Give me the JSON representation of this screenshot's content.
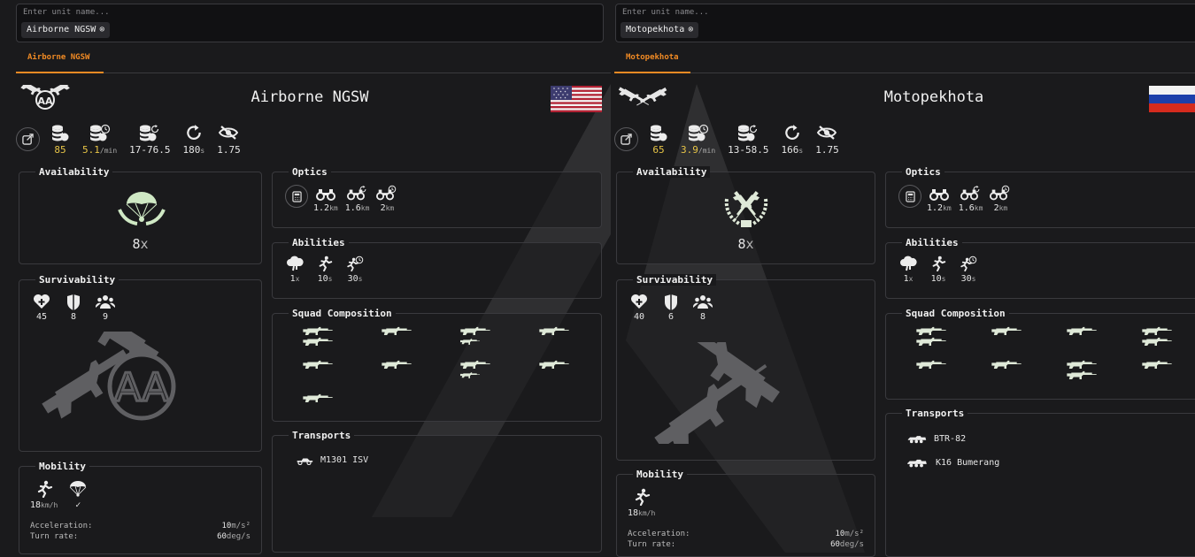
{
  "left": {
    "search": {
      "placeholder": "Enter unit name...",
      "chip": "Airborne NGSW"
    },
    "tab": "Airborne NGSW",
    "unit_name": "Airborne NGSW",
    "flag": "usa",
    "stats": {
      "cost": "85",
      "income": "5.1",
      "income_unit": "/min",
      "resupply": "17-76.5",
      "reload": "180",
      "reload_unit": "s",
      "stealth": "1.75"
    },
    "availability": {
      "title": "Availability",
      "count": "8",
      "suffix": "x"
    },
    "survivability": {
      "title": "Survivability",
      "health": "45",
      "armor": "8",
      "squad_size": "9"
    },
    "mobility": {
      "title": "Mobility",
      "speed": "18",
      "speed_unit": "km/h",
      "airdrop": "✓",
      "acceleration_label": "Acceleration:",
      "acceleration": "10",
      "acceleration_unit": "m/s²",
      "turn_label": "Turn rate:",
      "turn": "60",
      "turn_unit": "deg/s"
    },
    "optics": {
      "title": "Optics",
      "o1": "1.2",
      "o2": "1.6",
      "o3": "2",
      "unit": "km"
    },
    "abilities": {
      "title": "Abilities",
      "smoke": "1",
      "smoke_unit": "x",
      "sprint": "10",
      "sprint_unit": "s",
      "cooldown": "30",
      "cooldown_unit": "s"
    },
    "squad": {
      "title": "Squad Composition"
    },
    "transports": {
      "title": "Transports",
      "items": [
        "M1301 ISV"
      ]
    }
  },
  "right": {
    "search": {
      "placeholder": "Enter unit name...",
      "chip": "Motopekhota"
    },
    "tab": "Motopekhota",
    "unit_name": "Motopekhota",
    "flag": "russia",
    "stats": {
      "cost": "65",
      "income": "3.9",
      "income_unit": "/min",
      "resupply": "13-58.5",
      "reload": "166",
      "reload_unit": "s",
      "stealth": "1.75"
    },
    "availability": {
      "title": "Availability",
      "count": "8",
      "suffix": "x"
    },
    "survivability": {
      "title": "Survivability",
      "health": "40",
      "armor": "6",
      "squad_size": "8"
    },
    "mobility": {
      "title": "Mobility",
      "speed": "18",
      "speed_unit": "km/h",
      "acceleration_label": "Acceleration:",
      "acceleration": "10",
      "acceleration_unit": "m/s²",
      "turn_label": "Turn rate:",
      "turn": "60",
      "turn_unit": "deg/s"
    },
    "optics": {
      "title": "Optics",
      "o1": "1.2",
      "o2": "1.6",
      "o3": "2",
      "unit": "km"
    },
    "abilities": {
      "title": "Abilities",
      "smoke": "1",
      "smoke_unit": "x",
      "sprint": "10",
      "sprint_unit": "s",
      "cooldown": "30",
      "cooldown_unit": "s"
    },
    "squad": {
      "title": "Squad Composition"
    },
    "transports": {
      "title": "Transports",
      "items": [
        "BTR-82",
        "K16 Bumerang"
      ]
    }
  },
  "colors": {
    "accent": "#f08a24",
    "yellow": "#e8c547",
    "panel_border": "#3a3a3e",
    "background": "#1a1a1c"
  }
}
